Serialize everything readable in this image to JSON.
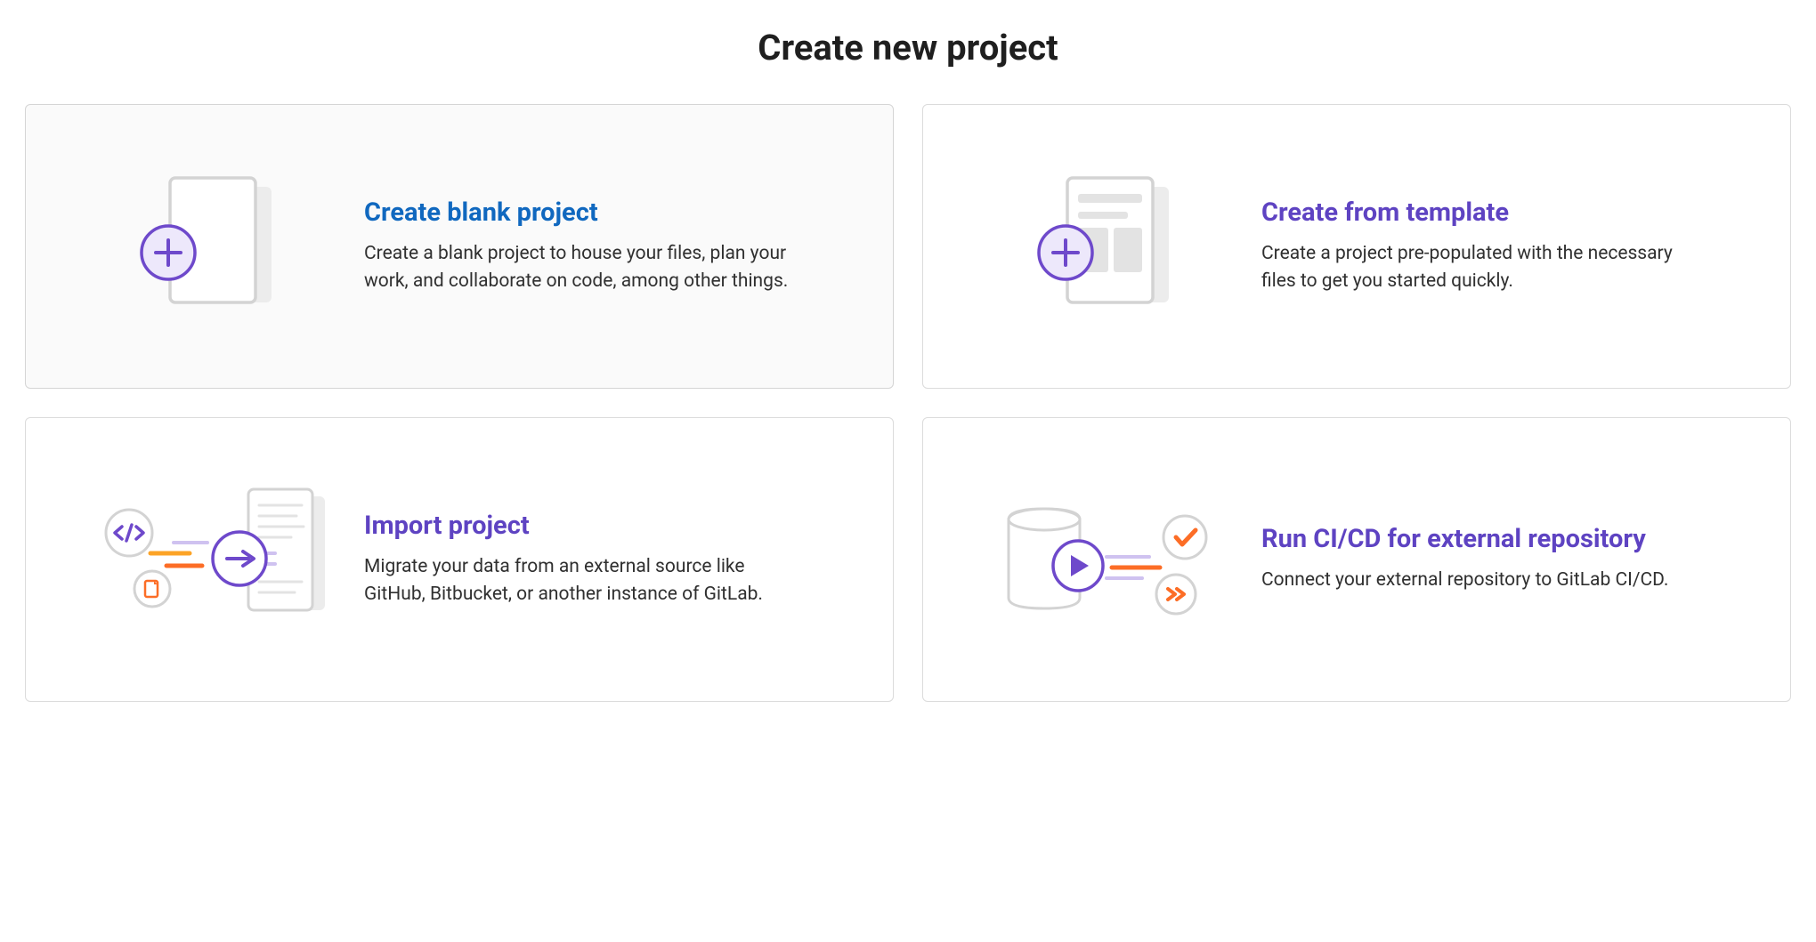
{
  "page": {
    "title": "Create new project"
  },
  "panels": {
    "blank": {
      "title": "Create blank project",
      "desc": "Create a blank project to house your files, plan your work, and collaborate on code, among other things."
    },
    "template": {
      "title": "Create from template",
      "desc": "Create a project pre-populated with the necessary files to get you started quickly."
    },
    "import": {
      "title": "Import project",
      "desc": "Migrate your data from an external source like GitHub, Bitbucket, or another instance of GitLab."
    },
    "cicd": {
      "title": "Run CI/CD for external repository",
      "desc": "Connect your external repository to GitLab CI/CD."
    }
  }
}
